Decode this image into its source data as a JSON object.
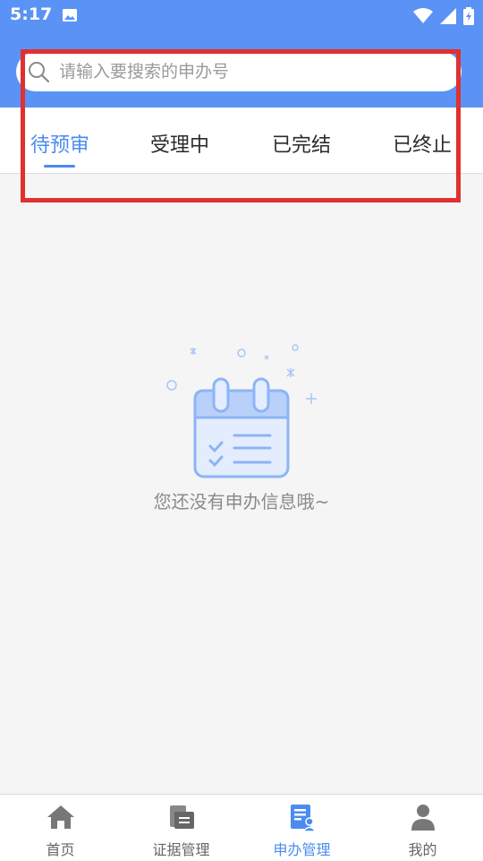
{
  "status_bar": {
    "time": "5:17"
  },
  "search": {
    "placeholder": "请输入要搜索的申办号",
    "value": ""
  },
  "tabs": [
    {
      "label": "待预审",
      "active": true
    },
    {
      "label": "受理中",
      "active": false
    },
    {
      "label": "已完结",
      "active": false
    },
    {
      "label": "已终止",
      "active": false
    }
  ],
  "empty_state": {
    "message": "您还没有申办信息哦~"
  },
  "bottom_nav": [
    {
      "label": "首页",
      "icon": "home-icon",
      "active": false
    },
    {
      "label": "证据管理",
      "icon": "evidence-folder-icon",
      "active": false
    },
    {
      "label": "申办管理",
      "icon": "application-manage-icon",
      "active": true
    },
    {
      "label": "我的",
      "icon": "person-icon",
      "active": false
    }
  ],
  "colors": {
    "brand_blue": "#5a93f5",
    "active_tab": "#4a8cf0",
    "highlight_red": "#e03030"
  }
}
